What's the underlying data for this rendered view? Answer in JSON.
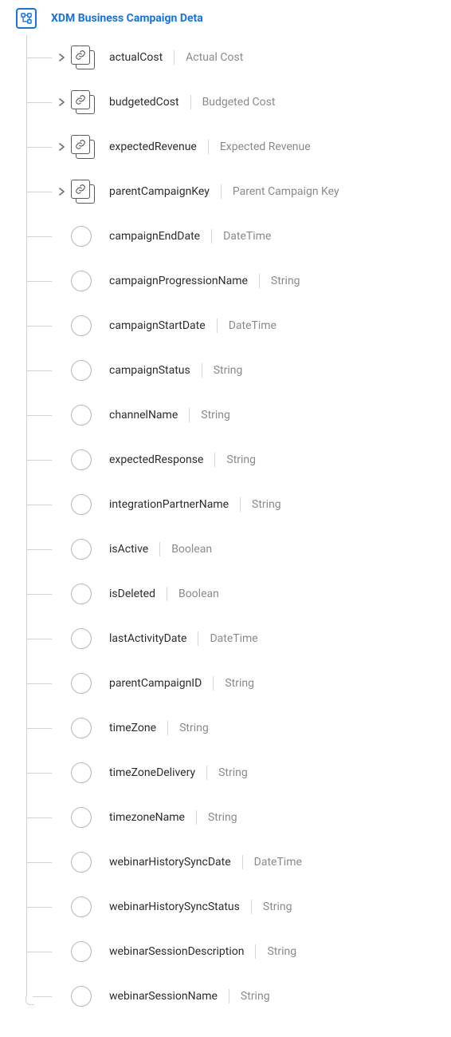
{
  "header": {
    "title": "XDM Business Campaign Deta"
  },
  "object_nodes": [
    {
      "name": "actualCost",
      "display": "Actual Cost"
    },
    {
      "name": "budgetedCost",
      "display": "Budgeted Cost"
    },
    {
      "name": "expectedRevenue",
      "display": "Expected Revenue"
    },
    {
      "name": "parentCampaignKey",
      "display": "Parent Campaign Key"
    }
  ],
  "field_nodes": [
    {
      "name": "campaignEndDate",
      "type": "DateTime"
    },
    {
      "name": "campaignProgressionName",
      "type": "String"
    },
    {
      "name": "campaignStartDate",
      "type": "DateTime"
    },
    {
      "name": "campaignStatus",
      "type": "String"
    },
    {
      "name": "channelName",
      "type": "String"
    },
    {
      "name": "expectedResponse",
      "type": "String"
    },
    {
      "name": "integrationPartnerName",
      "type": "String"
    },
    {
      "name": "isActive",
      "type": "Boolean"
    },
    {
      "name": "isDeleted",
      "type": "Boolean"
    },
    {
      "name": "lastActivityDate",
      "type": "DateTime"
    },
    {
      "name": "parentCampaignID",
      "type": "String"
    },
    {
      "name": "timeZone",
      "type": "String"
    },
    {
      "name": "timeZoneDelivery",
      "type": "String"
    },
    {
      "name": "timezoneName",
      "type": "String"
    },
    {
      "name": "webinarHistorySyncDate",
      "type": "DateTime"
    },
    {
      "name": "webinarHistorySyncStatus",
      "type": "String"
    },
    {
      "name": "webinarSessionDescription",
      "type": "String"
    },
    {
      "name": "webinarSessionName",
      "type": "String"
    }
  ]
}
